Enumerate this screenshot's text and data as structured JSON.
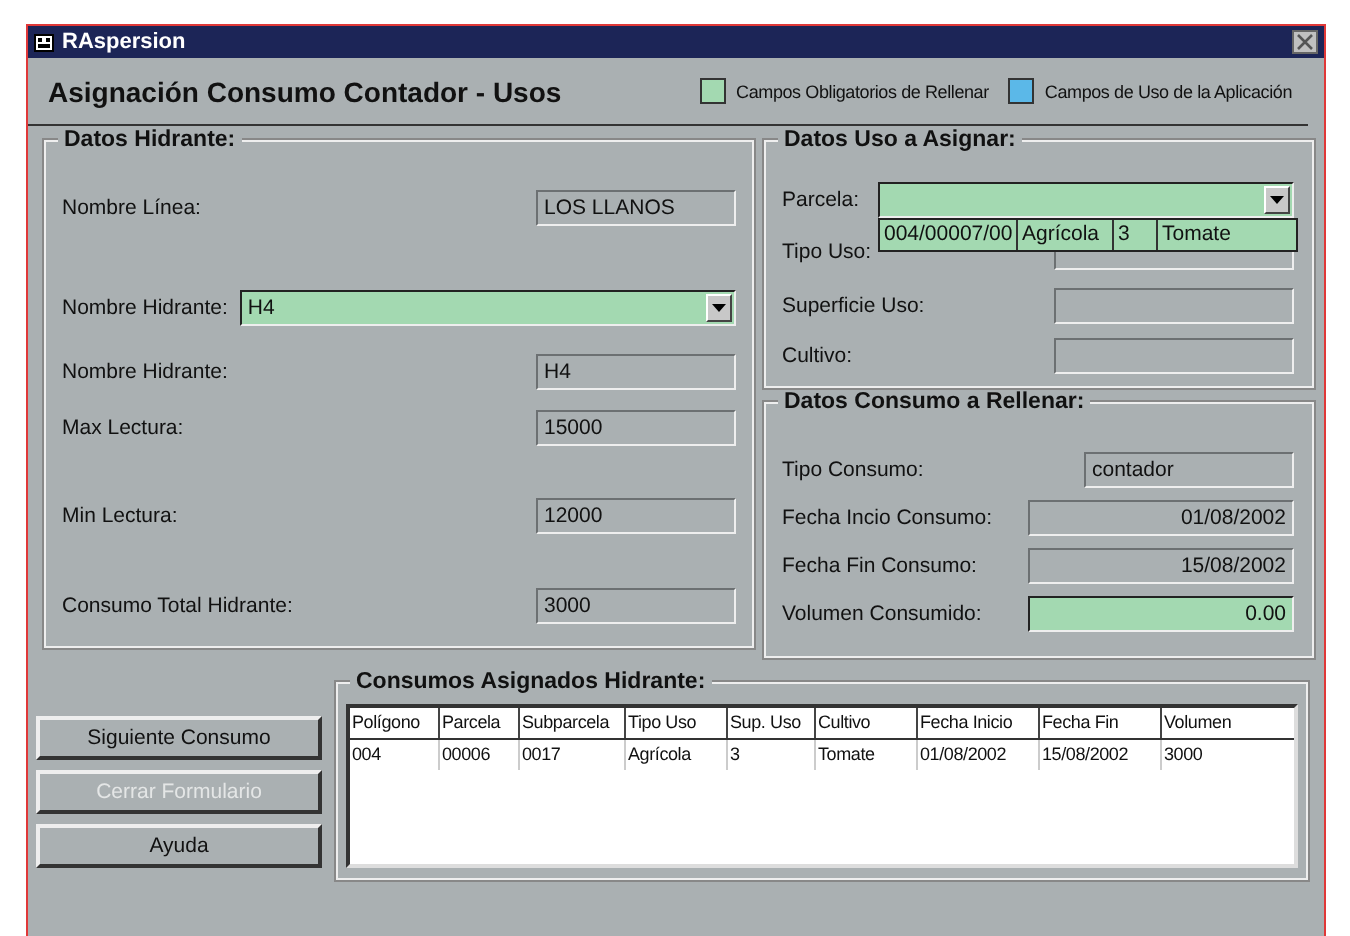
{
  "window": {
    "title": "RAspersion"
  },
  "header": {
    "title": "Asignación Consumo Contador - Usos",
    "legend": [
      {
        "label": "Campos Obligatorios de Rellenar",
        "color": "#a3d9b1"
      },
      {
        "label": "Campos de Uso de la Aplicación",
        "color": "#5bb8e8"
      }
    ]
  },
  "datos_hidrante": {
    "title": "Datos Hidrante:",
    "fields": [
      {
        "label": "Nombre Línea:",
        "value": "LOS LLANOS",
        "kind": "readonly"
      },
      {
        "label": "Nombre Hidrante:",
        "value": "H4",
        "kind": "combo"
      },
      {
        "label": "Nombre Hidrante:",
        "value": "H4",
        "kind": "readonly"
      },
      {
        "label": "Max Lectura:",
        "value": "15000",
        "kind": "readonly"
      },
      {
        "label": "Min Lectura:",
        "value": "12000",
        "kind": "readonly"
      },
      {
        "label": "Consumo Total Hidrante:",
        "value": "3000",
        "kind": "readonly"
      }
    ]
  },
  "datos_uso": {
    "title": "Datos Uso a Asignar:",
    "fields": [
      {
        "label": "Parcela:",
        "kind": "combo",
        "dropdown": {
          "options": [
            {
              "cells": [
                "004/00007/00",
                "Agrícola",
                "3",
                "Tomate"
              ]
            }
          ]
        }
      },
      {
        "label": "Tipo Uso:",
        "kind": "readonly"
      },
      {
        "label": "Superficie Uso:",
        "kind": "readonly"
      },
      {
        "label": "Cultivo:",
        "kind": "readonly"
      }
    ]
  },
  "datos_consumo": {
    "title": "Datos Consumo a Rellenar:",
    "fields": [
      {
        "label": "Tipo Consumo:",
        "value": "contador",
        "kind": "readonly"
      },
      {
        "label": "Fecha Incio Consumo:",
        "value": "01/08/2002",
        "kind": "date"
      },
      {
        "label": "Fecha Fin Consumo:",
        "value": "15/08/2002",
        "kind": "date"
      },
      {
        "label": "Volumen Consumido:",
        "value": "0.00",
        "kind": "required"
      }
    ]
  },
  "buttons": [
    {
      "label": "Siguiente Consumo",
      "disabled": false
    },
    {
      "label": "Cerrar Formulario",
      "disabled": true
    },
    {
      "label": "Ayuda",
      "disabled": false
    }
  ],
  "consumos": {
    "title": "Consumos Asignados Hidrante:",
    "columns": [
      "Polígono",
      "Parcela",
      "Subparcela",
      "Tipo Uso",
      "Sup. Uso",
      "Cultivo",
      "Fecha Inicio",
      "Fecha Fin",
      "Volumen"
    ],
    "rows": [
      [
        "004",
        "00006",
        "0017",
        "Agrícola",
        "3",
        "Tomate",
        "01/08/2002",
        "15/08/2002",
        "3000"
      ]
    ]
  }
}
